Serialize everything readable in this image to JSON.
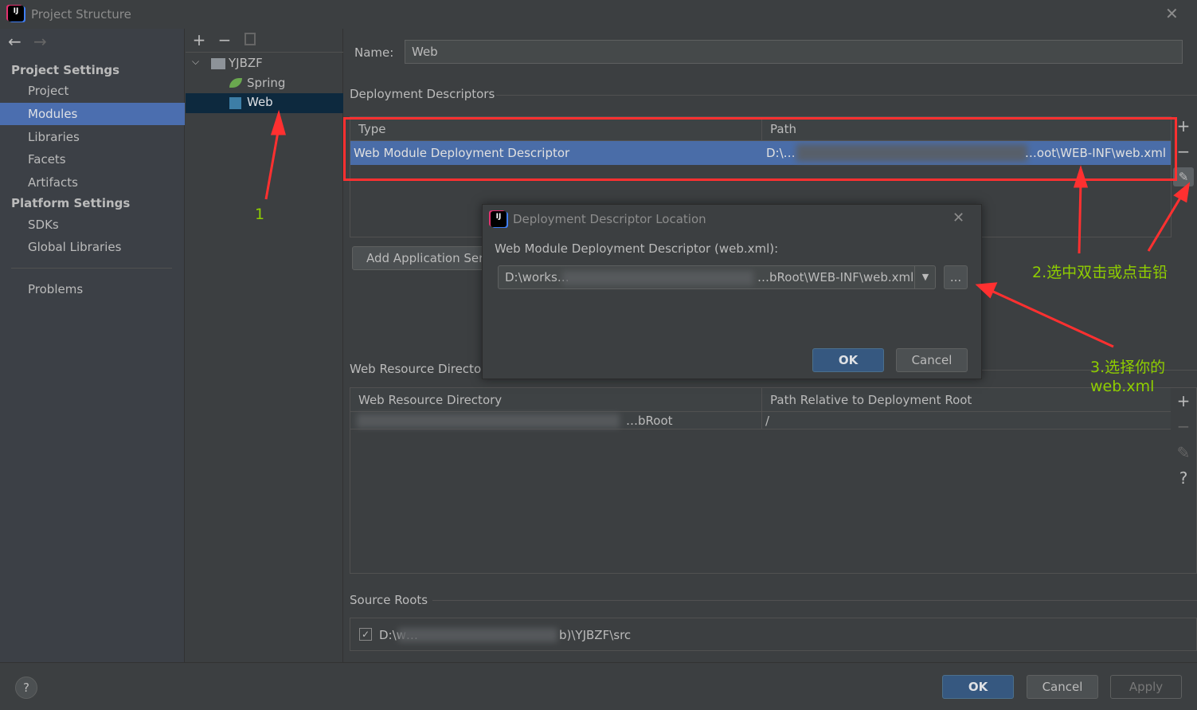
{
  "window": {
    "title": "Project Structure",
    "close_icon": "close-icon"
  },
  "sidebar": {
    "project_settings": "Project Settings",
    "project_items": [
      "Project",
      "Modules",
      "Libraries",
      "Facets",
      "Artifacts"
    ],
    "platform_settings": "Platform Settings",
    "platform_items": [
      "SDKs",
      "Global Libraries"
    ],
    "problems": "Problems",
    "selected": "Modules"
  },
  "tree": {
    "root": "YJBZF",
    "children": [
      "Spring",
      "Web"
    ],
    "selected": "Web"
  },
  "main": {
    "name_label": "Name:",
    "name_value": "Web",
    "deployment_descriptors": "Deployment Descriptors",
    "dd_columns": [
      "Type",
      "Path"
    ],
    "dd_rows": [
      {
        "type": "Web Module Deployment Descriptor",
        "path_start": "D:\\…",
        "path_end": "…oot\\WEB-INF\\web.xml"
      }
    ],
    "add_app_server": "Add Application Server specific descriptor...",
    "web_resource_dirs": "Web Resource Directories",
    "wr_columns": [
      "Web Resource Directory",
      "Path Relative to Deployment Root"
    ],
    "wr_rows": [
      {
        "dir": "…bRoot",
        "rel": "/"
      }
    ],
    "source_roots": "Source Roots",
    "source_root_path_start": "D:\\w…",
    "source_root_path_end": "b)\\YJBZF\\src",
    "source_root_checked": true
  },
  "dialog": {
    "title": "Deployment Descriptor Location",
    "label": "Web Module Deployment Descriptor (web.xml):",
    "path_start": "D:\\works…",
    "path_end": "…bRoot\\WEB-INF\\web.xml",
    "browse": "...",
    "ok": "OK",
    "cancel": "Cancel"
  },
  "footer": {
    "help": "?",
    "ok": "OK",
    "cancel": "Cancel",
    "apply": "Apply"
  },
  "annotations": {
    "a1": "1",
    "a2": "2.选中双击或点击铅",
    "a3_line1": "3.选择你的",
    "a3_line2": "web.xml",
    "color": "#8fce00",
    "arrow_color": "#ff3030"
  }
}
